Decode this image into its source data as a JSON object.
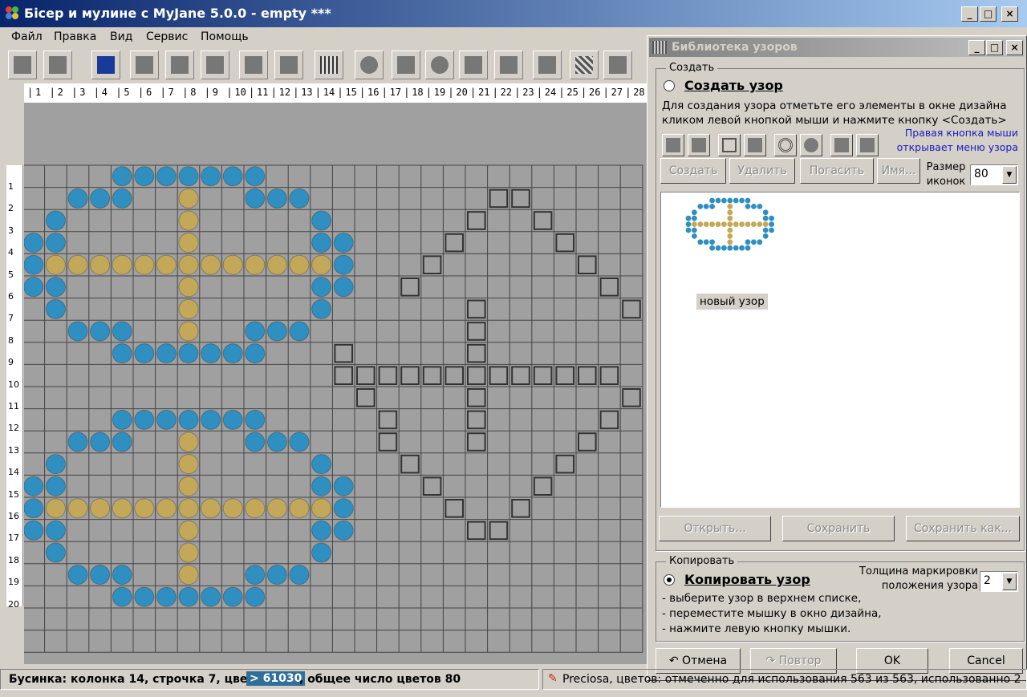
{
  "window": {
    "title": "Бісер и мулине с MyJane 5.0.0 - empty ***",
    "min": "_",
    "max": "□",
    "close": "×"
  },
  "menu": [
    "Файл",
    "Правка",
    "Вид",
    "Сервис",
    "Помощь"
  ],
  "toolbar": {
    "icons": [
      "select-icon",
      "open-icon",
      "save-icon",
      "cut-icon",
      "copy-icon",
      "paste-icon",
      "undo-icon",
      "redo-icon",
      "grid-icon",
      "bead-icon",
      "figure-icon",
      "speech-icon",
      "effect-icon",
      "layers-icon",
      "fill-icon",
      "pattern-icon",
      "frame-icon"
    ]
  },
  "ruler": {
    "columns": [
      "1",
      "2",
      "3",
      "4",
      "5",
      "6",
      "7",
      "8",
      "9",
      "10",
      "11",
      "12",
      "13",
      "14",
      "15",
      "16",
      "17",
      "18",
      "19",
      "20",
      "21",
      "22",
      "23",
      "24",
      "25",
      "26",
      "27",
      "28"
    ],
    "rows": [
      "1",
      "2",
      "3",
      "4",
      "5",
      "6",
      "7",
      "8",
      "9",
      "10",
      "11",
      "12",
      "13",
      "14",
      "15",
      "16",
      "17",
      "18",
      "19",
      "20"
    ]
  },
  "colors": {
    "blue_bead": "#2f8fc0",
    "gold_bead": "#c4a85a",
    "canvas": "#a0a0a0",
    "grid": "#444444"
  },
  "library": {
    "title": "Библиотека узоров",
    "create_group": "Создать",
    "create_radio": "Создать узор",
    "create_help": "Для создания узора отметьте его элементы в окне дизайна кликом левой кнопкой мыши и нажмите кнопку <Создать>",
    "right_click_note_1": "Правая кнопка мыши",
    "right_click_note_2": "открывает меню узора",
    "buttons": {
      "create": "Создать",
      "delete": "Удалить",
      "hide": "Погасить",
      "name": "Имя...",
      "open": "Открыть...",
      "save": "Сохранить",
      "save_as": "Сохранить как..."
    },
    "icon_size_label_1": "Размер",
    "icon_size_label_2": "иконок",
    "icon_size_value": "80",
    "pattern_caption": "новый узор",
    "copy_group": "Копировать",
    "copy_radio": "Копировать узор",
    "marking_label_1": "Толщина маркировки",
    "marking_label_2": "положения узора",
    "marking_value": "2",
    "steps": [
      "- выберите узор в верхнем списке,",
      "- переместите мышку в окно дизайна,",
      "- нажмите левую кнопку мышки."
    ],
    "footer": {
      "undo": "Отмена",
      "redo": "Повтор",
      "ok": "OK",
      "cancel": "Cancel"
    }
  },
  "status": {
    "left": "Бусинка: колонка 14, строчка 7, цвет",
    "color_code": "61030",
    "color_arrow": ">",
    "after": ", общее число цветов 80",
    "right": "Preciosa, цветов: отмеченно для использования 563 из 563, использованно 2"
  }
}
